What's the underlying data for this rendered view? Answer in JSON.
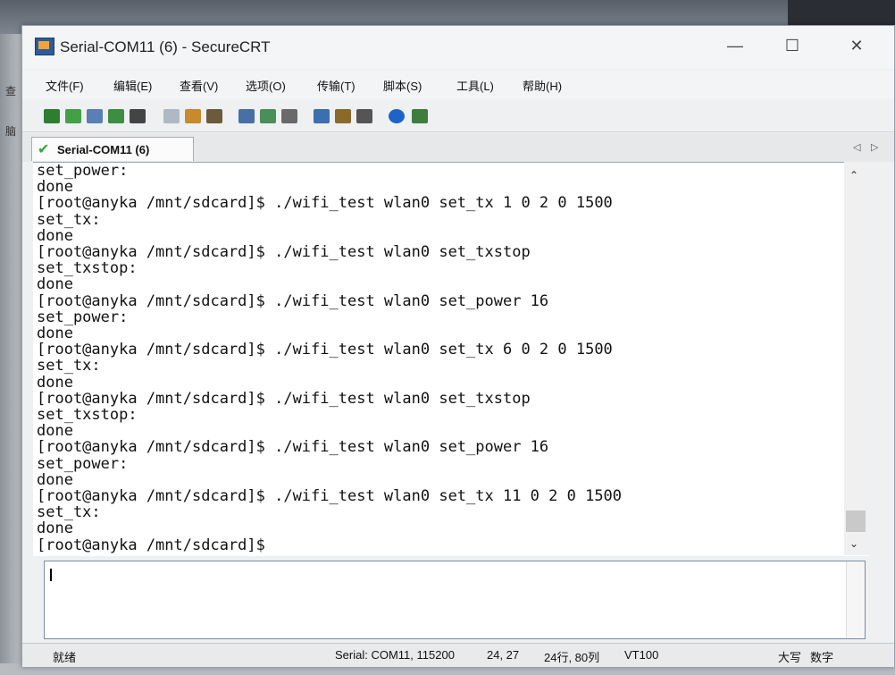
{
  "window": {
    "title": "Serial-COM11 (6) - SecureCRT",
    "controls": {
      "minimize": "—",
      "maximize": "☐",
      "close": "✕"
    }
  },
  "background": {
    "left_chars": [
      "查",
      "脑"
    ]
  },
  "menu": {
    "items": [
      "文件(F)",
      "编辑(E)",
      "查看(V)",
      "选项(O)",
      "传输(T)",
      "脚本(S)",
      "工具(L)",
      "帮助(H)"
    ]
  },
  "toolbar": {
    "icons": [
      {
        "name": "connect-icon",
        "color": "#2e7d32"
      },
      {
        "name": "quick-connect-icon",
        "color": "#43a047"
      },
      {
        "name": "connect-tab-icon",
        "color": "#5a7fb5"
      },
      {
        "name": "reconnect-icon",
        "color": "#3e8e41"
      },
      {
        "name": "disconnect-icon",
        "color": "#444444"
      },
      {
        "name": "copy-icon",
        "color": "#b0b8c4"
      },
      {
        "name": "paste-icon",
        "color": "#c78a2c"
      },
      {
        "name": "find-icon",
        "color": "#6b5b3a"
      },
      {
        "name": "print-icon",
        "color": "#4a6fa5"
      },
      {
        "name": "print-setup-icon",
        "color": "#4a8f5a"
      },
      {
        "name": "print-selection-icon",
        "color": "#6a6a6a"
      },
      {
        "name": "session-options-icon",
        "color": "#3c6fb0"
      },
      {
        "name": "global-options-icon",
        "color": "#8a6a2a"
      },
      {
        "name": "keymap-icon",
        "color": "#555555"
      },
      {
        "name": "help-icon",
        "color": "#1e63c8"
      },
      {
        "name": "sftp-icon",
        "color": "#3f7d3f"
      }
    ]
  },
  "tab": {
    "label": "Serial-COM11 (6)",
    "prev": "◁",
    "next": "▷"
  },
  "terminal": {
    "lines": [
      "set_power:",
      "done",
      "[root@anyka /mnt/sdcard]$ ./wifi_test wlan0 set_tx 1 0 2 0 1500",
      "set_tx:",
      "done",
      "[root@anyka /mnt/sdcard]$ ./wifi_test wlan0 set_txstop",
      "set_txstop:",
      "done",
      "[root@anyka /mnt/sdcard]$ ./wifi_test wlan0 set_power 16",
      "set_power:",
      "done",
      "[root@anyka /mnt/sdcard]$ ./wifi_test wlan0 set_tx 6 0 2 0 1500",
      "set_tx:",
      "done",
      "[root@anyka /mnt/sdcard]$ ./wifi_test wlan0 set_txstop",
      "set_txstop:",
      "done",
      "[root@anyka /mnt/sdcard]$ ./wifi_test wlan0 set_power 16",
      "set_power:",
      "done",
      "[root@anyka /mnt/sdcard]$ ./wifi_test wlan0 set_tx 11 0 2 0 1500",
      "set_tx:",
      "done",
      "[root@anyka /mnt/sdcard]$"
    ]
  },
  "scroll": {
    "up": "⌃",
    "down": "⌄"
  },
  "status": {
    "ready": "就绪",
    "connection": "Serial: COM11, 115200",
    "cursor": "24, 27",
    "size": "24行, 80列",
    "emulation": "VT100",
    "caps": "大写",
    "num": "数字"
  }
}
